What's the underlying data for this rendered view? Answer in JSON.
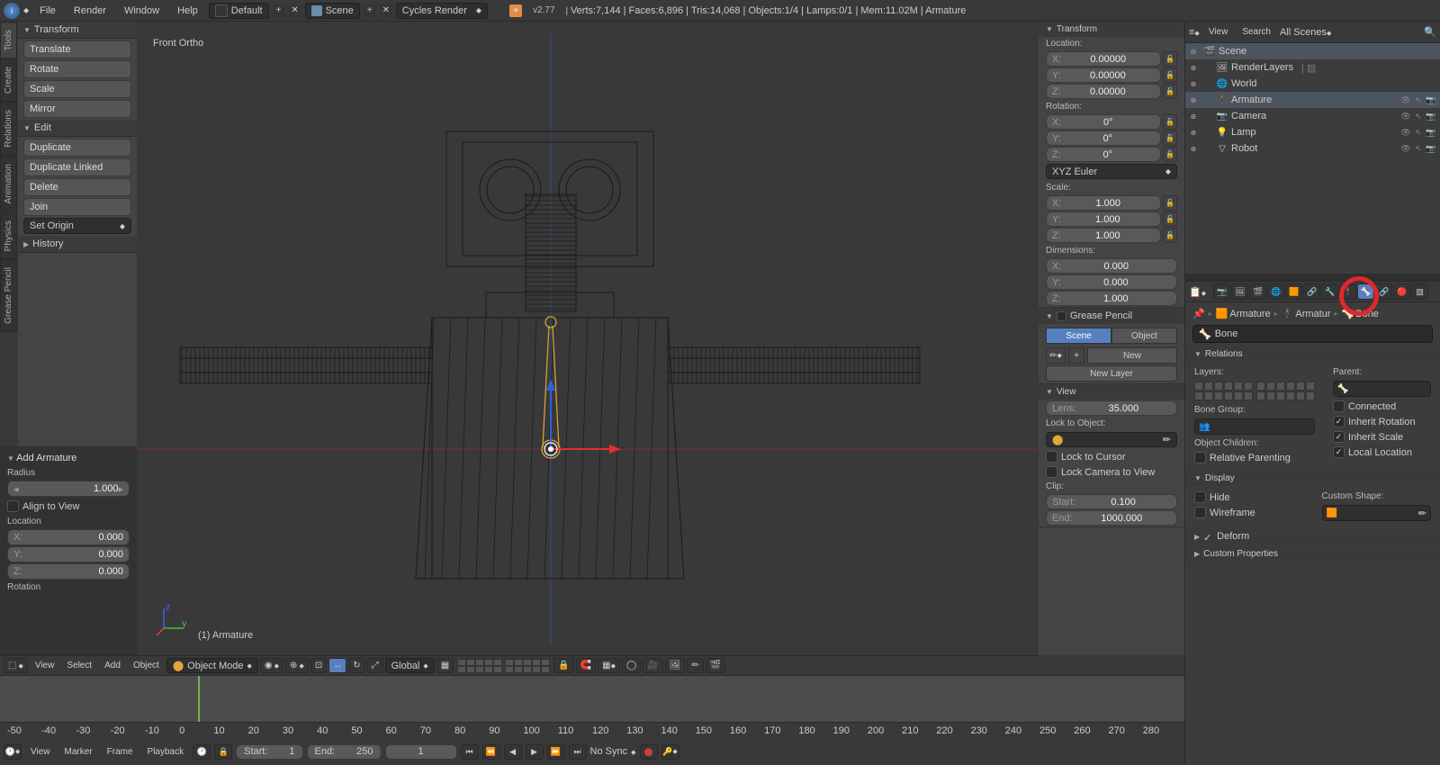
{
  "header": {
    "menus": [
      "File",
      "Render",
      "Window",
      "Help"
    ],
    "layout": "Default",
    "scene": "Scene",
    "renderer": "Cycles Render",
    "version": "v2.77",
    "stats": "Verts:7,144 | Faces:6,896 | Tris:14,068 | Objects:1/4 | Lamps:0/1 | Mem:11.02M | Armature"
  },
  "left_tabs": [
    "Tools",
    "Create",
    "Relations",
    "Animation",
    "Physics",
    "Grease Pencil"
  ],
  "toolshelf": {
    "transform": {
      "title": "Transform",
      "buttons": [
        "Translate",
        "Rotate",
        "Scale",
        "Mirror"
      ]
    },
    "edit": {
      "title": "Edit",
      "buttons": [
        "Duplicate",
        "Duplicate Linked",
        "Delete",
        "Join"
      ],
      "dd": "Set Origin"
    },
    "history": {
      "title": "History"
    }
  },
  "add_armature": {
    "title": "Add Armature",
    "radius_label": "Radius",
    "radius": "1.000",
    "align_label": "Align to View",
    "location_label": "Location",
    "loc": {
      "x": "X:",
      "y": "Y:",
      "z": "Z:",
      "xv": "0.000",
      "yv": "0.000",
      "zv": "0.000"
    },
    "rotation_label": "Rotation"
  },
  "viewport": {
    "top_label": "Front Ortho",
    "bottom_label": "(1) Armature"
  },
  "vp_header": {
    "menus": [
      "View",
      "Select",
      "Add",
      "Object"
    ],
    "mode": "Object Mode",
    "orientation": "Global"
  },
  "npanel": {
    "transform": {
      "title": "Transform",
      "location": "Location:",
      "rotation": "Rotation:",
      "scale": "Scale:",
      "dimensions": "Dimensions:",
      "loc": {
        "x": "X:",
        "y": "Y:",
        "z": "Z:",
        "v": "0.00000"
      },
      "rot": {
        "v": "0°"
      },
      "rot_mode": "XYZ Euler",
      "scl": {
        "v": "1.000"
      },
      "dim": {
        "xv": "0.000",
        "yv": "0.000",
        "zv": "1.000"
      }
    },
    "gp": {
      "title": "Grease Pencil",
      "scene": "Scene",
      "object": "Object",
      "new": "New",
      "new_layer": "New Layer"
    },
    "view": {
      "title": "View",
      "lens_l": "Lens:",
      "lens_v": "35.000",
      "lto": "Lock to Object:",
      "ltc": "Lock to Cursor",
      "lcv": "Lock Camera to View",
      "clip": "Clip:",
      "start_l": "Start:",
      "start_v": "0.100",
      "end_l": "End:",
      "end_v": "1000.000"
    }
  },
  "outliner": {
    "hdr": {
      "view": "View",
      "search": "Search",
      "filter": "All Scenes"
    },
    "items": [
      {
        "name": "Scene",
        "indent": 0,
        "icon": "🎬",
        "sel": true
      },
      {
        "name": "RenderLayers",
        "indent": 1,
        "icon": "🖼",
        "extra": "|"
      },
      {
        "name": "World",
        "indent": 1,
        "icon": "🌐"
      },
      {
        "name": "Armature",
        "indent": 1,
        "icon": "🕴",
        "sel": true,
        "right": true
      },
      {
        "name": "Camera",
        "indent": 1,
        "icon": "📷",
        "right": true
      },
      {
        "name": "Lamp",
        "indent": 1,
        "icon": "💡",
        "right": true
      },
      {
        "name": "Robot",
        "indent": 1,
        "icon": "▽",
        "right": true
      }
    ]
  },
  "properties": {
    "breadcrumb": [
      "Armature",
      "Armatur",
      "Bone"
    ],
    "bone_name": "Bone",
    "relations": {
      "title": "Relations",
      "layers": "Layers:",
      "parent": "Parent:",
      "bone_group": "Bone Group:",
      "obj_children": "Object Children:",
      "relpar": "Relative Parenting",
      "connected": "Connected",
      "inh_rot": "Inherit Rotation",
      "inh_scale": "Inherit Scale",
      "loc_loc": "Local Location"
    },
    "display": {
      "title": "Display",
      "hide": "Hide",
      "wireframe": "Wireframe",
      "custom": "Custom Shape:"
    },
    "deform": {
      "title": "Deform"
    },
    "custom_props": {
      "title": "Custom Properties"
    }
  },
  "timeline": {
    "menus": [
      "View",
      "Marker",
      "Frame",
      "Playback"
    ],
    "start_l": "Start:",
    "start_v": "1",
    "end_l": "End:",
    "end_v": "250",
    "cur": "1",
    "sync": "No Sync",
    "ticks": [
      "-50",
      "-40",
      "-30",
      "-20",
      "-10",
      "0",
      "10",
      "20",
      "30",
      "40",
      "50",
      "60",
      "70",
      "80",
      "90",
      "100",
      "110",
      "120",
      "130",
      "140",
      "150",
      "160",
      "170",
      "180",
      "190",
      "200",
      "210",
      "220",
      "230",
      "240",
      "250",
      "260",
      "270",
      "280"
    ]
  }
}
